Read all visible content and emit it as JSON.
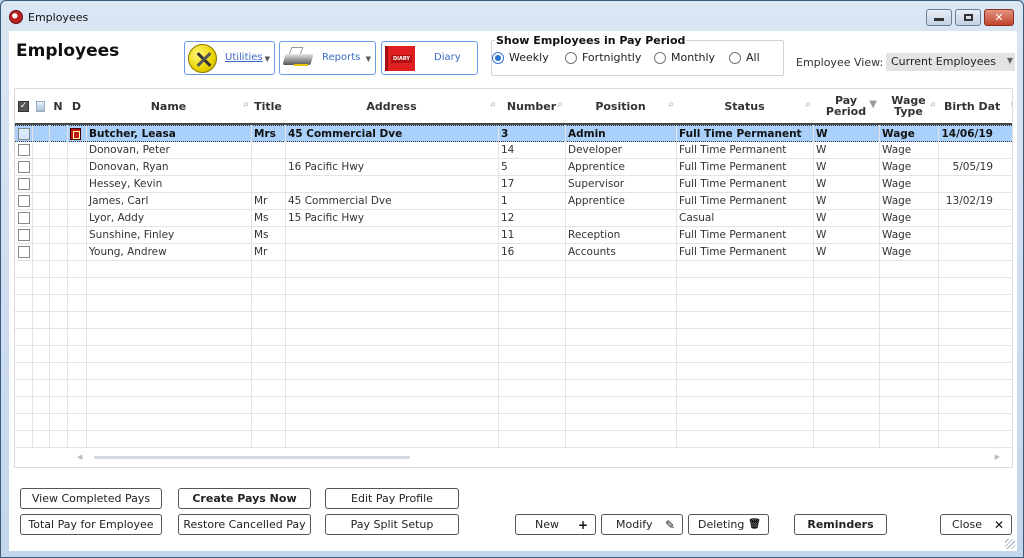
{
  "window": {
    "title": "Employees",
    "controls": [
      "minimize",
      "maximize",
      "close"
    ]
  },
  "header": {
    "page_title": "Employees",
    "toolbar": [
      {
        "label": "Utilities",
        "icon": "tools-icon",
        "has_dropdown": true
      },
      {
        "label": "Reports",
        "icon": "printer-icon",
        "has_dropdown": true
      },
      {
        "label": "Diary",
        "icon": "diary-icon",
        "has_dropdown": false
      }
    ],
    "pay_period": {
      "legend": "Show Employees in Pay Period",
      "options": [
        "Weekly",
        "Fortnightly",
        "Monthly",
        "All"
      ],
      "selected": "Weekly"
    },
    "employee_view": {
      "label": "Employee View:",
      "value": "Current Employees"
    }
  },
  "grid": {
    "columns": {
      "n": "N",
      "d": "D",
      "name": "Name",
      "title": "Title",
      "address": "Address",
      "number": "Number",
      "position": "Position",
      "status": "Status",
      "pay_period": "Pay Period",
      "wage_type": "Wage Type",
      "birth_date": "Birth Dat"
    },
    "rows": [
      {
        "name": "Butcher, Leasa",
        "title": "Mrs",
        "address": "45 Commercial Dve",
        "number": "3",
        "position": "Admin",
        "status": "Full Time Permanent",
        "pay_period": "W",
        "wage_type": "Wage",
        "birth_date": "14/06/19",
        "selected": true,
        "has_diary": true
      },
      {
        "name": "Donovan, Peter",
        "title": "",
        "address": "",
        "number": "14",
        "position": "Developer",
        "status": "Full Time Permanent",
        "pay_period": "W",
        "wage_type": "Wage",
        "birth_date": ""
      },
      {
        "name": "Donovan, Ryan",
        "title": "",
        "address": "16 Pacific Hwy",
        "number": "5",
        "position": "Apprentice",
        "status": "Full Time Permanent",
        "pay_period": "W",
        "wage_type": "Wage",
        "birth_date": "5/05/19"
      },
      {
        "name": "Hessey, Kevin",
        "title": "",
        "address": "",
        "number": "17",
        "position": "Supervisor",
        "status": "Full Time Permanent",
        "pay_period": "W",
        "wage_type": "Wage",
        "birth_date": ""
      },
      {
        "name": "James, Carl",
        "title": "Mr",
        "address": "45 Commercial Dve",
        "number": "1",
        "position": "Apprentice",
        "status": "Full Time Permanent",
        "pay_period": "W",
        "wage_type": "Wage",
        "birth_date": "13/02/19"
      },
      {
        "name": "Lyor, Addy",
        "title": "Ms",
        "address": "15 Pacific Hwy",
        "number": "12",
        "position": "",
        "status": "Casual",
        "pay_period": "W",
        "wage_type": "Wage",
        "birth_date": ""
      },
      {
        "name": "Sunshine, Finley",
        "title": "Ms",
        "address": "",
        "number": "11",
        "position": "Reception",
        "status": "Full Time Permanent",
        "pay_period": "W",
        "wage_type": "Wage",
        "birth_date": ""
      },
      {
        "name": "Young, Andrew",
        "title": "Mr",
        "address": "",
        "number": "16",
        "position": "Accounts",
        "status": "Full Time Permanent",
        "pay_period": "W",
        "wage_type": "Wage",
        "birth_date": ""
      }
    ]
  },
  "footer": {
    "view_completed_pays": "View Completed Pays",
    "create_pays_now": "Create Pays Now",
    "edit_pay_profile": "Edit Pay Profile",
    "total_pay_for_employee": "Total Pay for Employee",
    "restore_cancelled_pay": "Restore Cancelled Pay",
    "pay_split_setup": "Pay Split Setup",
    "new": "New",
    "modify": "Modify",
    "deleting": "Deleting",
    "reminders": "Reminders",
    "close": "Close"
  }
}
